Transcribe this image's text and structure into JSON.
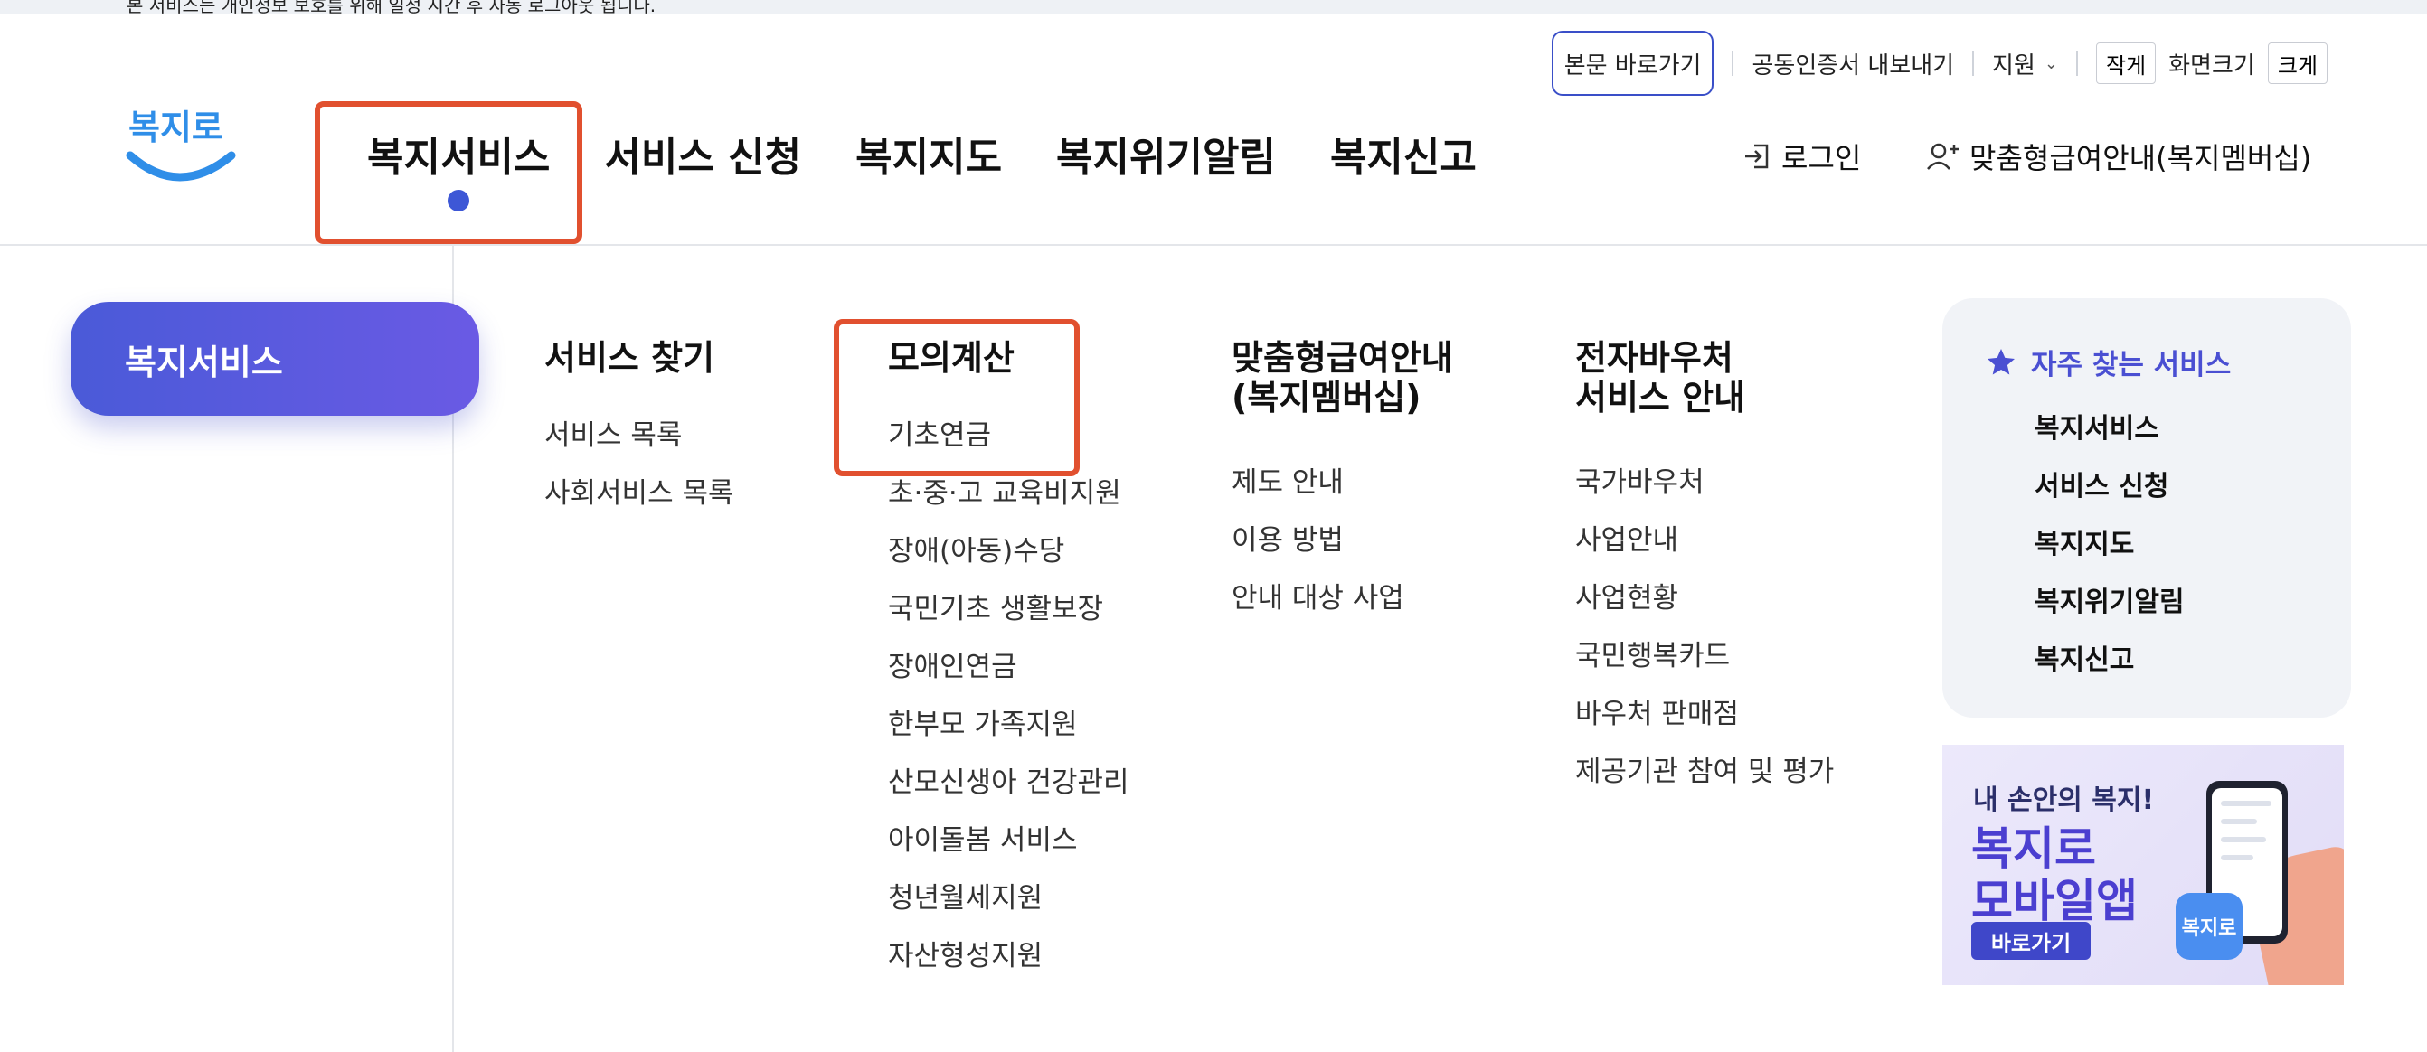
{
  "top_notice": "본 서비스는 개인정보 보호를 위해 일정 시간 후 자동 로그아웃 됩니다.",
  "utility": {
    "skip_to_content": "본문 바로가기",
    "cert_export": "공동인증서 내보내기",
    "support": "지원",
    "font_small": "작게",
    "font_size_label": "화면크기",
    "font_large": "크게"
  },
  "logo_text": "복지로",
  "gnb": [
    "복지서비스",
    "서비스 신청",
    "복지지도",
    "복지위기알림",
    "복지신고"
  ],
  "header_links": {
    "login": "로그인",
    "membership": "맞춤형급여안내(복지멤버십)"
  },
  "side_pill": "복지서비스",
  "columns": [
    {
      "title": "서비스 찾기",
      "items": [
        "서비스 목록",
        "사회서비스 목록"
      ]
    },
    {
      "title": "모의계산",
      "items": [
        "기초연금",
        "초·중·고 교육비지원",
        "장애(아동)수당",
        "국민기초 생활보장",
        "장애인연금",
        "한부모 가족지원",
        "산모신생아 건강관리",
        "아이돌봄 서비스",
        "청년월세지원",
        "자산형성지원"
      ]
    },
    {
      "title_line1": "맞춤형급여안내",
      "title_line2": "(복지멤버십)",
      "items": [
        "제도 안내",
        "이용 방법",
        "안내 대상 사업"
      ]
    },
    {
      "title_line1": "전자바우처",
      "title_line2": "서비스 안내",
      "items": [
        "국가바우처",
        "사업안내",
        "사업현황",
        "국민행복카드",
        "바우처 판매점",
        "제공기관 참여 및 평가"
      ]
    }
  ],
  "frequent": {
    "title": "자주 찾는 서비스",
    "items": [
      "복지서비스",
      "서비스 신청",
      "복지지도",
      "복지위기알림",
      "복지신고"
    ]
  },
  "banner": {
    "subtitle": "내 손안의 복지!",
    "line1": "복지로",
    "line2": "모바일앱",
    "button": "바로가기",
    "app_icon_text": "복지로"
  },
  "colors": {
    "accent": "#3d57d6",
    "highlight": "#e1502f",
    "pill_start": "#4a5ad8",
    "pill_end": "#6a5ae4"
  }
}
